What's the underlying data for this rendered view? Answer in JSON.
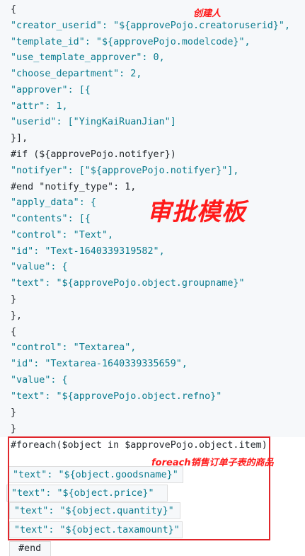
{
  "code": {
    "lines": [
      "{",
      "\"creator_userid\": \"${approvePojo.creatoruserid}\",",
      "\"template_id\": \"${approvePojo.modelcode}\",",
      "\"use_template_approver\": 0,",
      "\"choose_department\": 2,",
      "\"approver\": [{",
      "\"attr\": 1,",
      "\"userid\": [\"YingKaiRuanJian\"]",
      "}],",
      "#if (${approvePojo.notifyer})",
      "\"notifyer\": [\"${approvePojo.notifyer}\"],",
      "#end \"notify_type\": 1,",
      "\"apply_data\": {",
      "\"contents\": [{",
      "\"control\": \"Text\",",
      "\"id\": \"Text-1640339319582\",",
      "\"value\": {",
      "\"text\": \"${approvePojo.object.groupname}\"",
      "}",
      "},",
      "{",
      "\"control\": \"Textarea\",",
      "\"id\": \"Textarea-1640339335659\",",
      "\"value\": {",
      "\"text\": \"${approvePojo.object.refno}\"",
      "}",
      "}",
      "#foreach($object in $approvePojo.object.item)"
    ],
    "items": [
      "\"text\": \"${object.goodsname}\"",
      "\"text\": \"${object.price}\"",
      "\"text\": \"${object.quantity}\"",
      "\"text\": \"${object.taxamount}\""
    ],
    "end": "#end"
  },
  "annotations": {
    "creator": "创建人",
    "template": "审批模板",
    "foreach": "foreach销售订单子表的商品"
  },
  "colors": {
    "key": "#0a7b8f",
    "annotation": "#ff1a1a",
    "box": "#e0262b"
  }
}
